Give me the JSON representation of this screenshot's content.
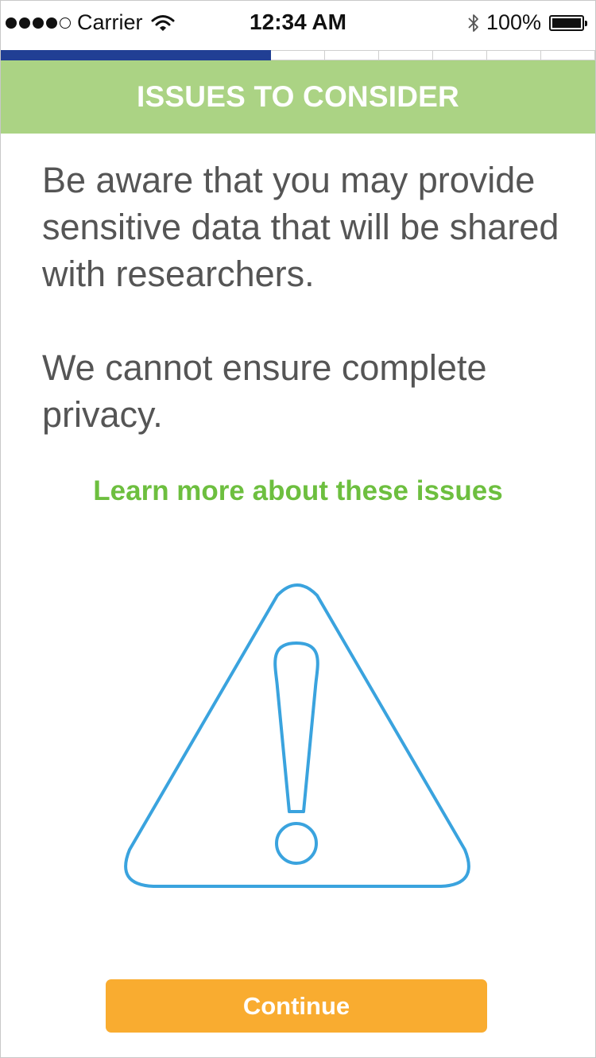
{
  "status_bar": {
    "carrier": "Carrier",
    "time": "12:34 AM",
    "battery": "100%",
    "signal_bars_filled": 4,
    "signal_bars_total": 5
  },
  "progress": {
    "current_step": 6,
    "total_steps": 12,
    "color": "#213f94"
  },
  "header": {
    "title": "ISSUES TO CONSIDER",
    "color": "#abd384"
  },
  "content": {
    "paragraph_1": "Be aware that you may provide sensitive data that will be shared with researchers.",
    "paragraph_2": "We cannot ensure complete privacy."
  },
  "links": {
    "learn_more": "Learn more about these issues",
    "color": "#6dbf3f"
  },
  "illustration": {
    "icon": "warning-triangle-icon",
    "color": "#3aa3de"
  },
  "actions": {
    "continue_label": "Continue",
    "color": "#f9ac30"
  }
}
